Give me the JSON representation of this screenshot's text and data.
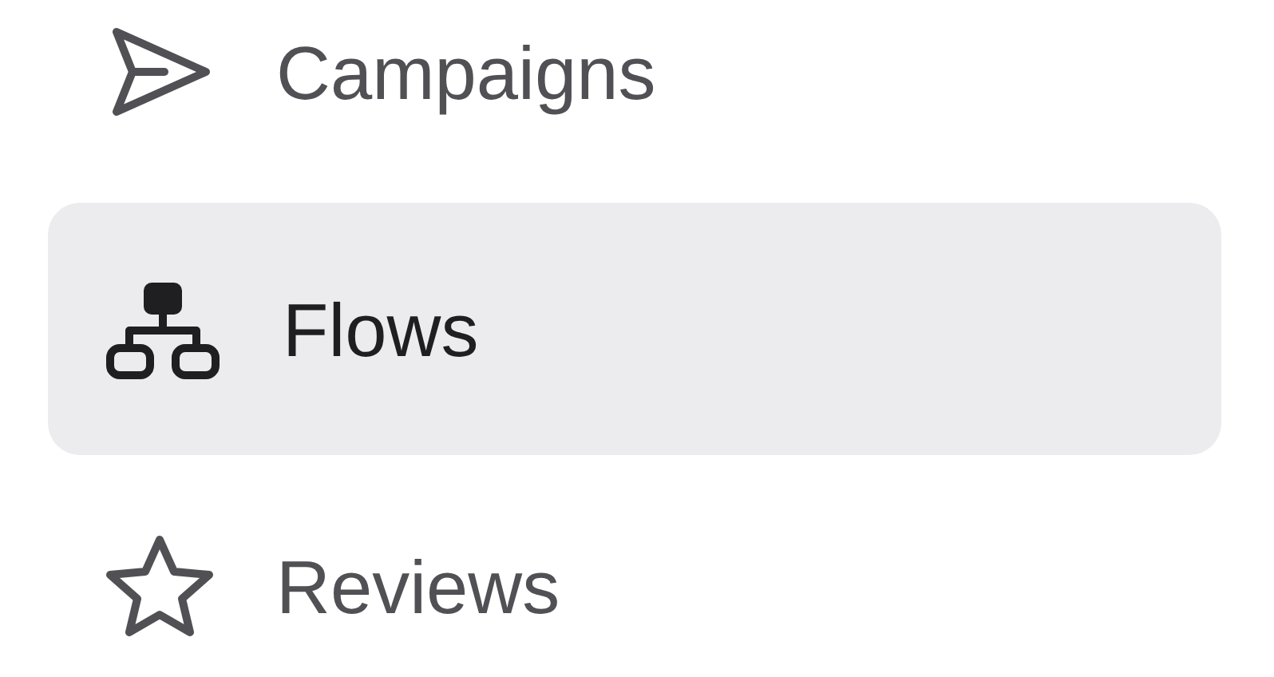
{
  "sidebar": {
    "items": [
      {
        "label": "Campaigns",
        "kind": "send",
        "selected": false
      },
      {
        "label": "Flows",
        "kind": "flow",
        "selected": true
      },
      {
        "label": "Reviews",
        "kind": "star",
        "selected": false
      }
    ]
  }
}
